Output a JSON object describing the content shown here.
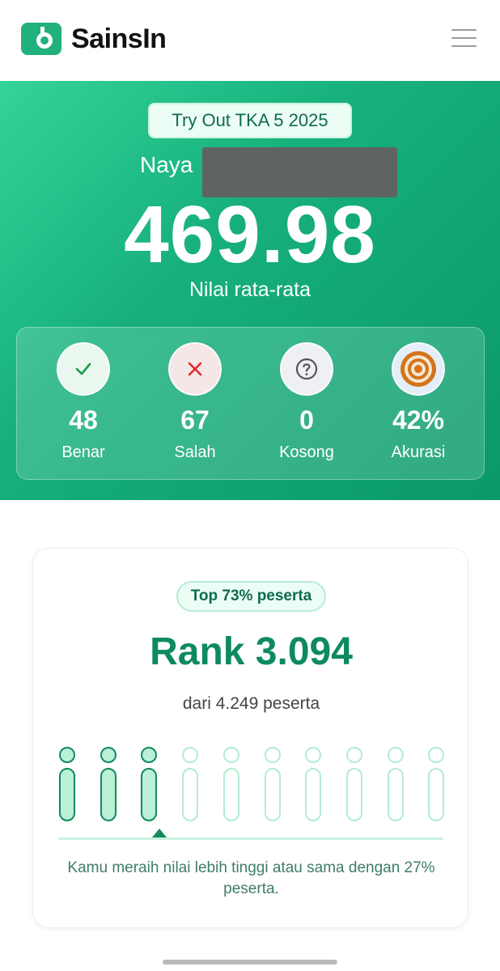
{
  "app": {
    "brand": "SainsIn"
  },
  "hero": {
    "event_title": "Try Out TKA 5 2025",
    "student_first_name": "Naya",
    "score": "469.98",
    "score_label": "Nilai rata-rata",
    "stats": [
      {
        "value": "48",
        "label": "Benar",
        "icon": "check-icon"
      },
      {
        "value": "67",
        "label": "Salah",
        "icon": "x-icon"
      },
      {
        "value": "0",
        "label": "Kosong",
        "icon": "question-icon"
      },
      {
        "value": "42%",
        "label": "Akurasi",
        "icon": "target-icon"
      }
    ]
  },
  "ranking": {
    "top_badge": "Top 73% peserta",
    "rank": "Rank 3.094",
    "subtitle": "dari 4.249 peserta",
    "percentile_filled_fraction": 0.3,
    "caption": "Kamu meraih nilai lebih tinggi atau sama dengan 27% peserta."
  },
  "colors": {
    "accent": "#17b07c",
    "accent_dark": "#0e8a5f",
    "check": "#1a9a4a",
    "cross": "#e0282b",
    "target": "#d5731a"
  }
}
